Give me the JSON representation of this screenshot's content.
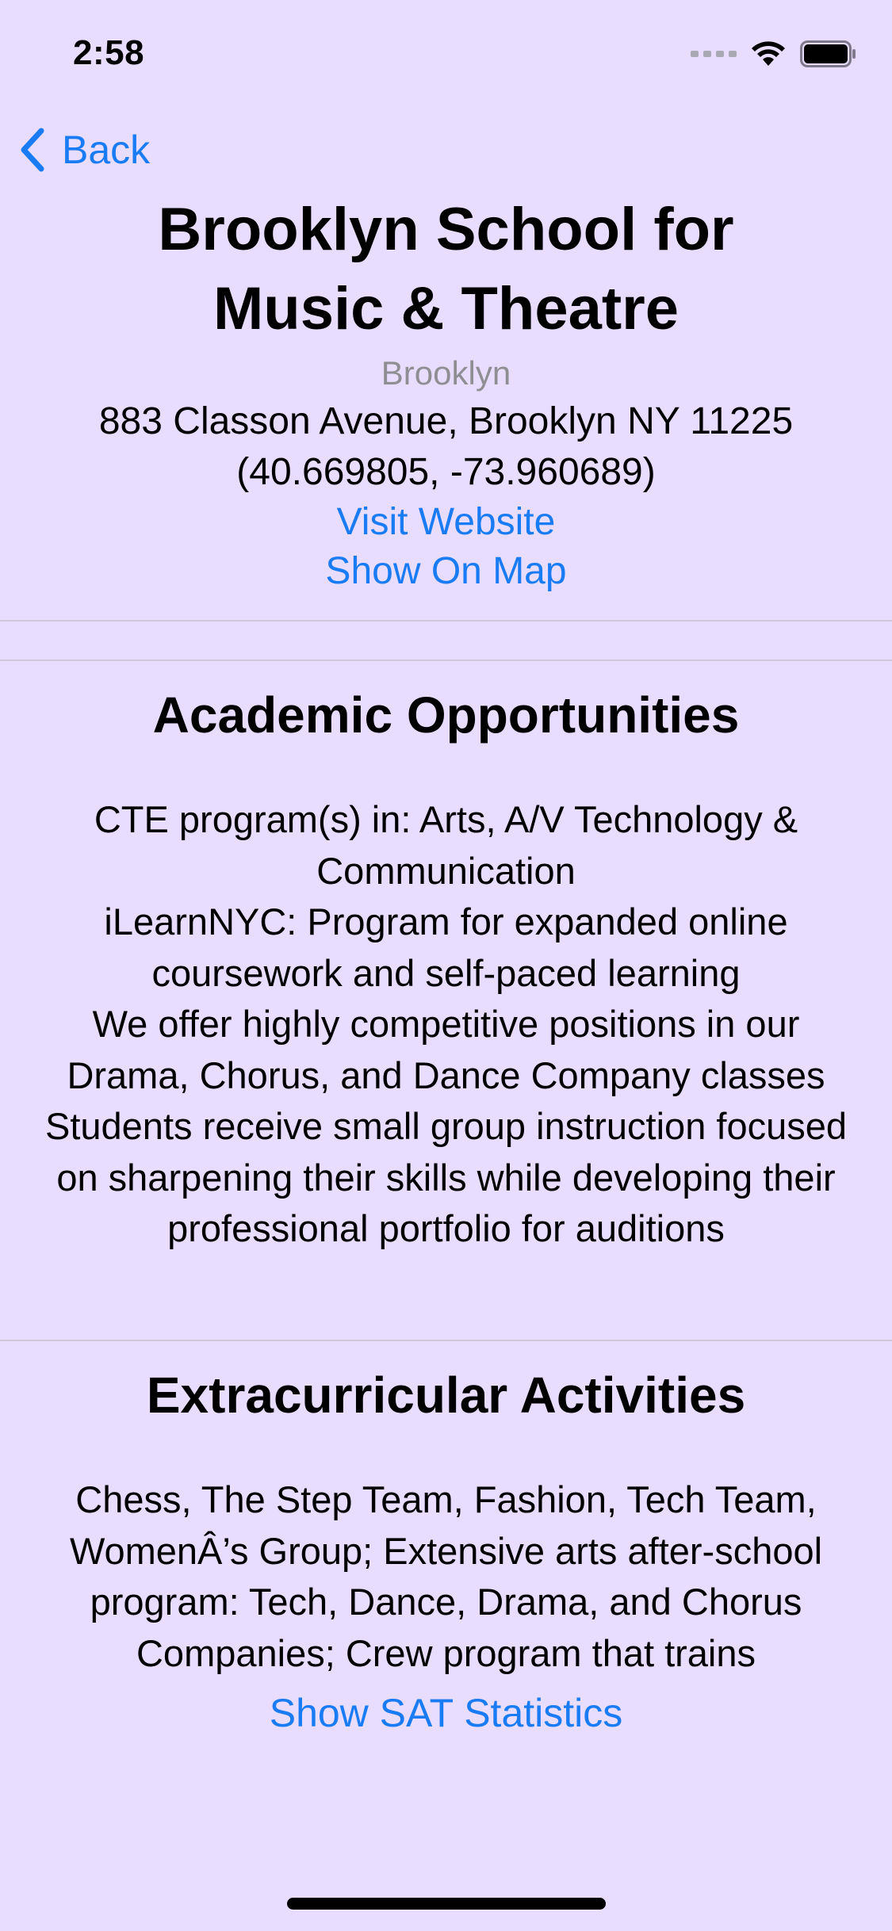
{
  "status_bar": {
    "time": "2:58"
  },
  "nav": {
    "back_label": "Back"
  },
  "school": {
    "name": "Brooklyn School for Music & Theatre",
    "borough": "Brooklyn",
    "address": "883 Classon Avenue, Brooklyn NY 11225",
    "coordinates": "(40.669805, -73.960689)",
    "website_link": "Visit Website",
    "map_link": "Show On Map"
  },
  "academic": {
    "title": "Academic Opportunities",
    "lines": [
      "CTE program(s) in: Arts, A/V Technology & Communication",
      "iLearnNYC: Program for expanded online coursework and self-paced learning",
      "We offer highly competitive positions in our Drama, Chorus, and Dance Company classes",
      "Students receive small group instruction focused on sharpening their skills while developing their professional portfolio for auditions"
    ]
  },
  "extracurricular": {
    "title": "Extracurricular Activities",
    "text": "Chess, The Step Team, Fashion, Tech Team, WomenÂ’s Group; Extensive arts after-school program: Tech, Dance, Drama, and Chorus Companies; Crew program that trains"
  },
  "sat_link": "Show SAT Statistics",
  "colors": {
    "background": "#e8ddff",
    "accent": "#1a7cf5",
    "secondary_text": "#8e8e93"
  }
}
